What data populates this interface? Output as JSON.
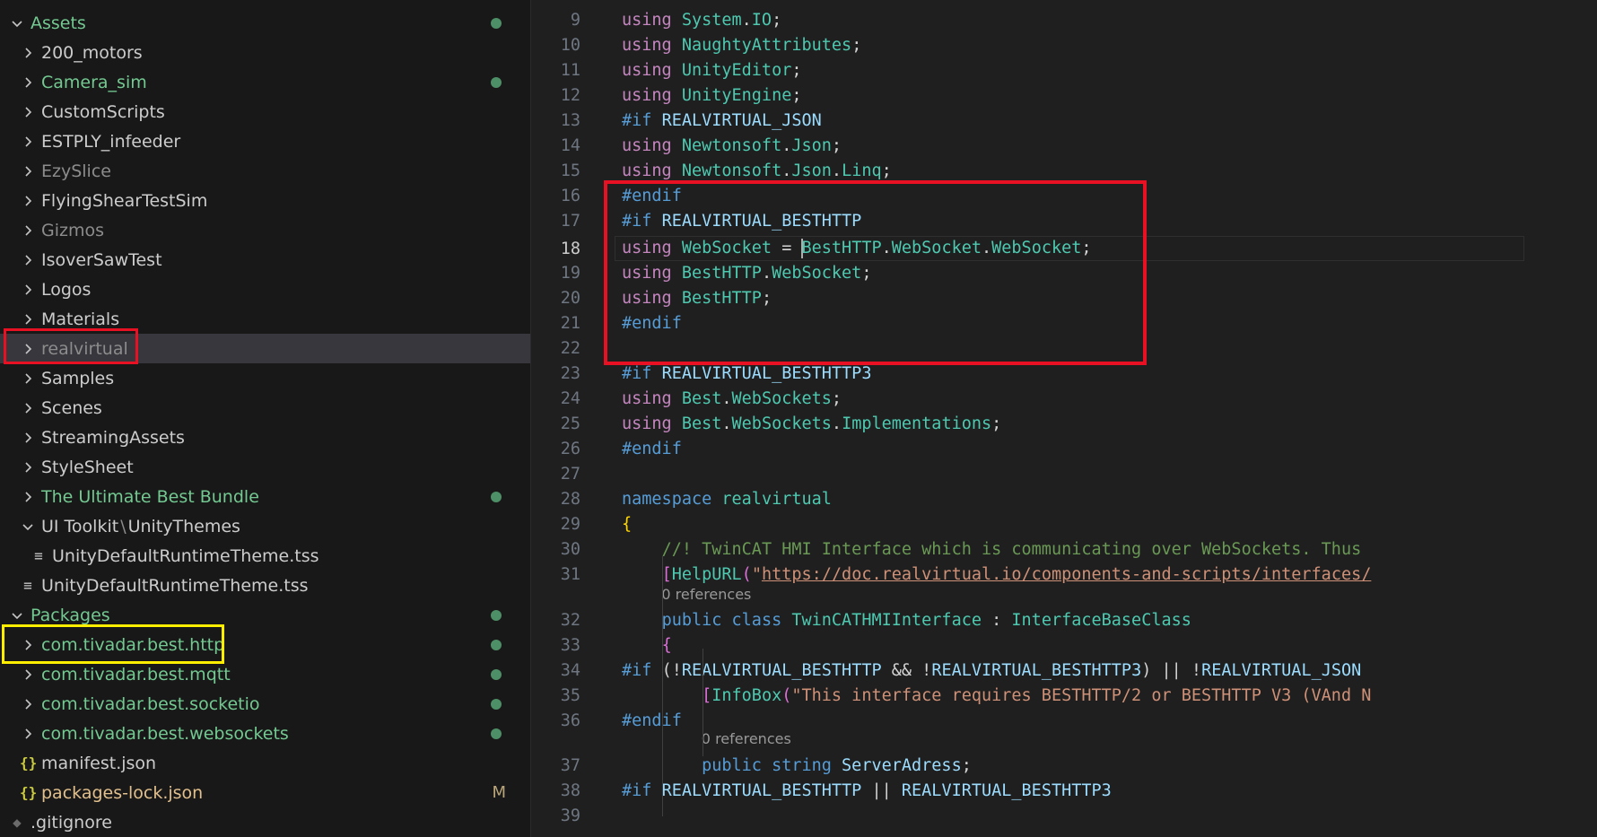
{
  "explorer": {
    "rows": [
      {
        "label": "Assets",
        "chev": "down",
        "level": 0,
        "color": "green",
        "badge": "dot"
      },
      {
        "label": "200_motors",
        "chev": "right",
        "level": 1,
        "color": "normal"
      },
      {
        "label": "Camera_sim",
        "chev": "right",
        "level": 1,
        "color": "green",
        "badge": "dot"
      },
      {
        "label": "CustomScripts",
        "chev": "right",
        "level": 1,
        "color": "normal"
      },
      {
        "label": "ESTPLY_infeeder",
        "chev": "right",
        "level": 1,
        "color": "normal"
      },
      {
        "label": "EzySlice",
        "chev": "right",
        "level": 1,
        "color": "dim"
      },
      {
        "label": "FlyingShearTestSim",
        "chev": "right",
        "level": 1,
        "color": "normal"
      },
      {
        "label": "Gizmos",
        "chev": "right",
        "level": 1,
        "color": "dim"
      },
      {
        "label": "IsoverSawTest",
        "chev": "right",
        "level": 1,
        "color": "normal"
      },
      {
        "label": "Logos",
        "chev": "right",
        "level": 1,
        "color": "normal"
      },
      {
        "label": "Materials",
        "chev": "right",
        "level": 1,
        "color": "normal"
      },
      {
        "label": "realvirtual",
        "chev": "right",
        "level": 1,
        "color": "dim",
        "selected": true
      },
      {
        "label": "Samples",
        "chev": "right",
        "level": 1,
        "color": "normal"
      },
      {
        "label": "Scenes",
        "chev": "right",
        "level": 1,
        "color": "normal"
      },
      {
        "label": "StreamingAssets",
        "chev": "right",
        "level": 1,
        "color": "normal"
      },
      {
        "label": "StyleSheet",
        "chev": "right",
        "level": 1,
        "color": "normal"
      },
      {
        "label": "The Ultimate Best Bundle",
        "chev": "right",
        "level": 1,
        "color": "green",
        "badge": "dot"
      },
      {
        "label": "UI Toolkit",
        "label2": "UnityThemes",
        "chev": "down",
        "level": 1,
        "color": "normal"
      },
      {
        "label": "UnityDefaultRuntimeTheme.tss",
        "icon": "lines",
        "level": 2,
        "color": "normal"
      },
      {
        "label": "UnityDefaultRuntimeTheme.tss",
        "icon": "lines",
        "level": 1,
        "color": "normal"
      },
      {
        "label": "Packages",
        "chev": "down",
        "level": 0,
        "color": "green",
        "badge": "dot"
      },
      {
        "label": "com.tivadar.best.http",
        "chev": "right",
        "level": 1,
        "color": "green",
        "badge": "dot"
      },
      {
        "label": "com.tivadar.best.mqtt",
        "chev": "right",
        "level": 1,
        "color": "green",
        "badge": "dot"
      },
      {
        "label": "com.tivadar.best.socketio",
        "chev": "right",
        "level": 1,
        "color": "green",
        "badge": "dot"
      },
      {
        "label": "com.tivadar.best.websockets",
        "chev": "right",
        "level": 1,
        "color": "green",
        "badge": "dot"
      },
      {
        "label": "manifest.json",
        "icon": "json",
        "level": 1,
        "color": "normal"
      },
      {
        "label": "packages-lock.json",
        "icon": "json",
        "level": 1,
        "color": "mod",
        "badge": "M"
      },
      {
        "label": ".gitignore",
        "icon": "git",
        "level": 0,
        "color": "normal"
      }
    ]
  },
  "editor": {
    "current_line": "18",
    "lines": [
      {
        "n": "9",
        "t": [
          [
            "using ",
            "ctl"
          ],
          [
            "System",
            "ns"
          ],
          [
            ".",
            "pl"
          ],
          [
            "IO",
            "ns"
          ],
          [
            ";",
            "pl"
          ]
        ]
      },
      {
        "n": "10",
        "t": [
          [
            "using ",
            "ctl"
          ],
          [
            "NaughtyAttributes",
            "ns"
          ],
          [
            ";",
            "pl"
          ]
        ]
      },
      {
        "n": "11",
        "t": [
          [
            "using ",
            "ctl"
          ],
          [
            "UnityEditor",
            "ns"
          ],
          [
            ";",
            "pl"
          ]
        ]
      },
      {
        "n": "12",
        "t": [
          [
            "using ",
            "ctl"
          ],
          [
            "UnityEngine",
            "ns"
          ],
          [
            ";",
            "pl"
          ]
        ]
      },
      {
        "n": "13",
        "t": [
          [
            "#if ",
            "pp"
          ],
          [
            "REALVIRTUAL_JSON",
            "id"
          ]
        ]
      },
      {
        "n": "14",
        "t": [
          [
            "using ",
            "ctl"
          ],
          [
            "Newtonsoft",
            "ns"
          ],
          [
            ".",
            "pl"
          ],
          [
            "Json",
            "ns"
          ],
          [
            ";",
            "pl"
          ]
        ]
      },
      {
        "n": "15",
        "t": [
          [
            "using ",
            "ctl"
          ],
          [
            "Newtonsoft",
            "ns"
          ],
          [
            ".",
            "pl"
          ],
          [
            "Json",
            "ns"
          ],
          [
            ".",
            "pl"
          ],
          [
            "Linq",
            "ns"
          ],
          [
            ";",
            "pl"
          ]
        ]
      },
      {
        "n": "16",
        "t": [
          [
            "#endif",
            "pp"
          ]
        ]
      },
      {
        "n": "17",
        "t": [
          [
            "#if ",
            "pp"
          ],
          [
            "REALVIRTUAL_BESTHTTP",
            "id"
          ]
        ]
      },
      {
        "n": "18",
        "t": [
          [
            "using ",
            "ctl"
          ],
          [
            "WebSocket",
            "ty"
          ],
          [
            " = ",
            "pl"
          ],
          [
            "|",
            "caret"
          ],
          [
            "BestHTTP",
            "ns"
          ],
          [
            ".",
            "pl"
          ],
          [
            "WebSocket",
            "ns"
          ],
          [
            ".",
            "pl"
          ],
          [
            "WebSocket",
            "ty"
          ],
          [
            ";",
            "pl"
          ]
        ]
      },
      {
        "n": "19",
        "t": [
          [
            "using ",
            "ctl"
          ],
          [
            "BestHTTP",
            "ns"
          ],
          [
            ".",
            "pl"
          ],
          [
            "WebSocket",
            "ns"
          ],
          [
            ";",
            "pl"
          ]
        ]
      },
      {
        "n": "20",
        "t": [
          [
            "using ",
            "ctl"
          ],
          [
            "BestHTTP",
            "ns"
          ],
          [
            ";",
            "pl"
          ]
        ]
      },
      {
        "n": "21",
        "t": [
          [
            "#endif",
            "pp"
          ]
        ]
      },
      {
        "n": "22",
        "t": []
      },
      {
        "n": "23",
        "t": [
          [
            "#if ",
            "pp"
          ],
          [
            "REALVIRTUAL_BESTHTTP3",
            "id"
          ]
        ]
      },
      {
        "n": "24",
        "t": [
          [
            "using ",
            "ctl"
          ],
          [
            "Best",
            "ns"
          ],
          [
            ".",
            "pl"
          ],
          [
            "WebSockets",
            "ns"
          ],
          [
            ";",
            "pl"
          ]
        ]
      },
      {
        "n": "25",
        "t": [
          [
            "using ",
            "ctl"
          ],
          [
            "Best",
            "ns"
          ],
          [
            ".",
            "pl"
          ],
          [
            "WebSockets",
            "ns"
          ],
          [
            ".",
            "pl"
          ],
          [
            "Implementations",
            "ns"
          ],
          [
            ";",
            "pl"
          ]
        ]
      },
      {
        "n": "26",
        "t": [
          [
            "#endif",
            "pp"
          ]
        ]
      },
      {
        "n": "27",
        "t": []
      },
      {
        "n": "28",
        "t": [
          [
            "namespace ",
            "kw"
          ],
          [
            "realvirtual",
            "ns"
          ]
        ]
      },
      {
        "n": "29",
        "t": [
          [
            "{",
            "br1"
          ]
        ]
      },
      {
        "n": "30",
        "t": [
          [
            "    ",
            "pl"
          ],
          [
            "//! TwinCAT HMI Interface which is communicating over WebSockets. Thus",
            "cm"
          ]
        ]
      },
      {
        "n": "31",
        "t": [
          [
            "    ",
            "pl"
          ],
          [
            "[",
            "br2"
          ],
          [
            "HelpURL",
            "ty"
          ],
          [
            "(",
            "br2"
          ],
          [
            "\"",
            "st"
          ],
          [
            "https://doc.realvirtual.io/components-and-scripts/interfaces/",
            "stu"
          ]
        ]
      },
      {
        "lens": "0 references",
        "indent": 4
      },
      {
        "n": "32",
        "t": [
          [
            "    ",
            "pl"
          ],
          [
            "public ",
            "kw"
          ],
          [
            "class ",
            "kw"
          ],
          [
            "TwinCATHMIInterface",
            "ty"
          ],
          [
            " : ",
            "pl"
          ],
          [
            "InterfaceBaseClass",
            "ty"
          ]
        ]
      },
      {
        "n": "33",
        "t": [
          [
            "    ",
            "pl"
          ],
          [
            "{",
            "br2"
          ]
        ]
      },
      {
        "n": "34",
        "t": [
          [
            "#if ",
            "pp"
          ],
          [
            "(",
            "pl"
          ],
          [
            "!",
            "pl"
          ],
          [
            "REALVIRTUAL_BESTHTTP",
            "id"
          ],
          [
            " && ",
            "pl"
          ],
          [
            "!",
            "pl"
          ],
          [
            "REALVIRTUAL_BESTHTTP3",
            "id"
          ],
          [
            ") || ",
            "pl"
          ],
          [
            "!",
            "pl"
          ],
          [
            "REALVIRTUAL_JSON",
            "id"
          ]
        ]
      },
      {
        "n": "35",
        "t": [
          [
            "        ",
            "pl"
          ],
          [
            "[",
            "br2"
          ],
          [
            "InfoBox",
            "ty"
          ],
          [
            "(",
            "br2"
          ],
          [
            "\"This interface requires BESTHTTP/2 or BESTHTTP V3 (VAnd N",
            "st"
          ]
        ]
      },
      {
        "n": "36",
        "t": [
          [
            "#endif",
            "pp"
          ]
        ]
      },
      {
        "lens": "0 references",
        "indent": 8
      },
      {
        "n": "37",
        "t": [
          [
            "        ",
            "pl"
          ],
          [
            "public ",
            "kw"
          ],
          [
            "string ",
            "kw"
          ],
          [
            "ServerAdress",
            "id"
          ],
          [
            ";",
            "pl"
          ]
        ]
      },
      {
        "n": "38",
        "t": [
          [
            "#if ",
            "pp"
          ],
          [
            "REALVIRTUAL_BESTHTTP",
            "id"
          ],
          [
            " || ",
            "pl"
          ],
          [
            "REALVIRTUAL_BESTHTTP3",
            "id"
          ]
        ]
      },
      {
        "n": "39",
        "t": []
      }
    ]
  },
  "highlights": [
    {
      "name": "red-highlight-box-realvirtual",
      "color": "#e81123"
    },
    {
      "name": "yellow-highlight-box-best-http",
      "color": "#ffee00"
    },
    {
      "name": "red-highlight-box-code",
      "color": "#e81123"
    }
  ]
}
